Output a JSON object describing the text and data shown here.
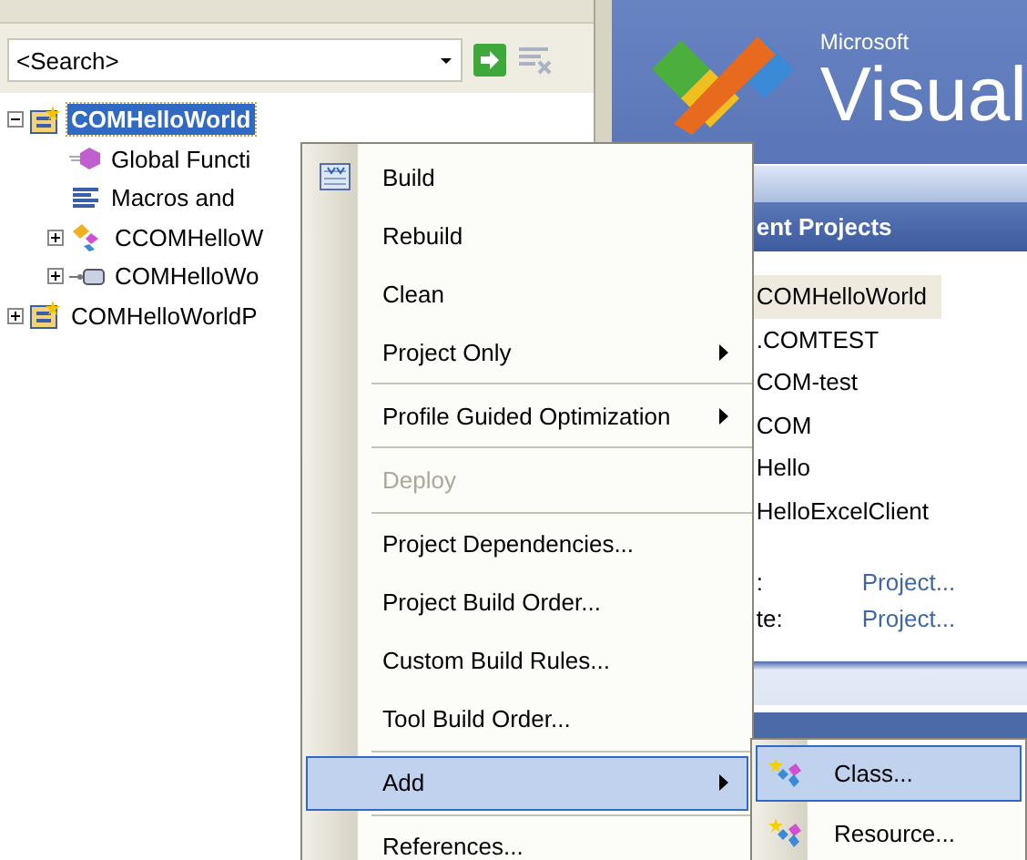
{
  "search": {
    "value": "<Search>"
  },
  "tree": [
    {
      "label": "COMHelloWorld",
      "kind": "project",
      "selected": true,
      "expanded": true,
      "children": [
        {
          "label": "Global Functi",
          "kind": "functions",
          "selected": false
        },
        {
          "label": "Macros and",
          "kind": "macros",
          "selected": false
        },
        {
          "label": "CCOMHelloW",
          "kind": "class",
          "selected": false,
          "expanded": false
        },
        {
          "label": "COMHelloWo",
          "kind": "interface",
          "selected": false,
          "expanded": false
        }
      ]
    },
    {
      "label": "COMHelloWorldP",
      "kind": "project",
      "selected": false,
      "expanded": false
    }
  ],
  "start_page": {
    "logo": {
      "brand": "Microsoft",
      "product": "Visual"
    },
    "recent_projects": {
      "title": "ent Projects",
      "items": [
        {
          "label": "COMHelloWorld",
          "selected": true
        },
        {
          "label": ".COMTEST",
          "selected": false
        },
        {
          "label": "COM-test",
          "selected": false
        },
        {
          "label": "COM",
          "selected": false
        },
        {
          "label": "Hello",
          "selected": false
        },
        {
          "label": "HelloExcelClient",
          "selected": false
        }
      ]
    },
    "actions": [
      {
        "label": ":",
        "link": "Project..."
      },
      {
        "label": "te:",
        "link": "Project..."
      }
    ]
  },
  "context_menu": [
    {
      "kind": "build",
      "label": "Build",
      "disabled": false,
      "selected": false
    },
    {
      "kind": "item",
      "label": "Rebuild",
      "disabled": false,
      "selected": false
    },
    {
      "kind": "item",
      "label": "Clean",
      "disabled": false,
      "selected": false
    },
    {
      "kind": "submenu",
      "label": "Project Only",
      "disabled": false,
      "selected": false
    },
    {
      "kind": "separator"
    },
    {
      "kind": "submenu",
      "label": "Profile Guided Optimization",
      "disabled": false,
      "selected": false
    },
    {
      "kind": "separator"
    },
    {
      "kind": "item",
      "label": "Deploy",
      "disabled": true,
      "selected": false
    },
    {
      "kind": "separator"
    },
    {
      "kind": "item",
      "label": "Project Dependencies...",
      "disabled": false,
      "selected": false
    },
    {
      "kind": "item",
      "label": "Project Build Order...",
      "disabled": false,
      "selected": false
    },
    {
      "kind": "item",
      "label": "Custom Build Rules...",
      "disabled": false,
      "selected": false
    },
    {
      "kind": "item",
      "label": "Tool Build Order...",
      "disabled": false,
      "selected": false
    },
    {
      "kind": "separator"
    },
    {
      "kind": "submenu",
      "label": "Add",
      "disabled": false,
      "selected": true
    },
    {
      "kind": "separator"
    },
    {
      "kind": "item",
      "label": "References...",
      "disabled": false,
      "selected": false
    }
  ],
  "submenu": [
    {
      "label": "Class...",
      "selected": true
    },
    {
      "label": "Resource...",
      "selected": false
    }
  ]
}
